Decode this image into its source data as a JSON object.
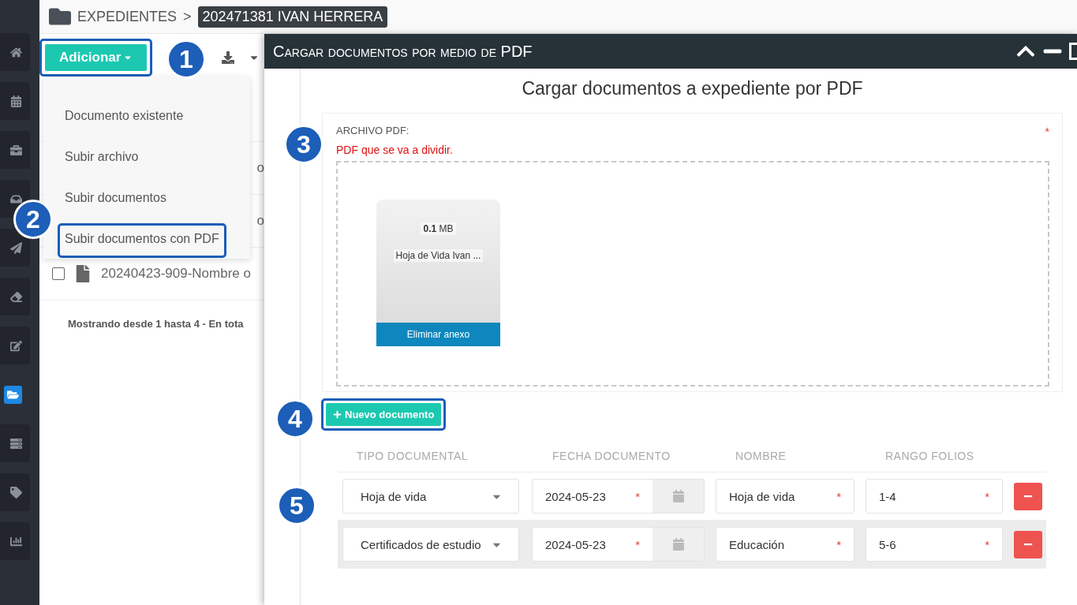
{
  "sidebar": {
    "items": [
      {
        "selected": false
      },
      {
        "selected": false
      },
      {
        "selected": false
      },
      {
        "selected": false
      },
      {
        "selected": false
      },
      {
        "selected": false
      },
      {
        "selected": false
      },
      {
        "selected": true
      },
      {
        "selected": false
      },
      {
        "selected": false
      },
      {
        "selected": false
      }
    ]
  },
  "breadcrumb": {
    "root": "EXPEDIENTES",
    "separator": ">",
    "current": "202471381 IVAN HERRERA"
  },
  "toolbar": {
    "add_button": {
      "label": "Adicionar",
      "highlighted": true
    }
  },
  "add_menu": {
    "items": [
      {
        "label": "Documento existente",
        "highlighted": false
      },
      {
        "label": "Subir archivo",
        "highlighted": false
      },
      {
        "label": "Subir documentos",
        "highlighted": false
      },
      {
        "label": "Subir documentos con PDF",
        "highlighted": true
      }
    ]
  },
  "list": {
    "rows": [
      {
        "text": "o"
      },
      {
        "text": "o"
      },
      {
        "text": "20240423-909-Nombre o",
        "checked": false
      }
    ],
    "footer": "Mostrando desde 1 hasta 4 - En tota"
  },
  "annotations": [
    {
      "label": "1"
    },
    {
      "label": "2"
    },
    {
      "label": "3"
    },
    {
      "label": "4"
    },
    {
      "label": "5"
    }
  ],
  "modal": {
    "title": "Cargar documentos por medio de PDF",
    "heading": "Cargar documentos a expediente por PDF",
    "file_field": {
      "label": "ARCHIVO PDF:",
      "mark": "*",
      "hint": "PDF que se va a dividir.",
      "files": [
        {
          "size": "0.1",
          "unit": "MB",
          "name": "Hoja de Vida Ivan ...",
          "remove_label": "Eliminar anexo"
        }
      ]
    },
    "new_button": {
      "label": "Nuevo documento",
      "highlighted": true
    },
    "columns": [
      "TIPO DOCUMENTAL",
      "FECHA DOCUMENTO",
      "NOMBRE",
      "RANGO FOLIOS"
    ],
    "rows": [
      {
        "tipo": "Hoja de vida",
        "fecha": {
          "value": "2024-05-23",
          "mark": "*"
        },
        "nombre": {
          "value": "Hoja de vida",
          "mark": "*"
        },
        "rango": {
          "value": "1-4",
          "mark": "*"
        },
        "shaded": false
      },
      {
        "tipo": "Certificados de estudio",
        "fecha": {
          "value": "2024-05-23",
          "mark": "*"
        },
        "nombre": {
          "value": "Educación",
          "mark": "*"
        },
        "rango": {
          "value": "5-6",
          "mark": "*"
        },
        "shaded": true
      }
    ]
  }
}
